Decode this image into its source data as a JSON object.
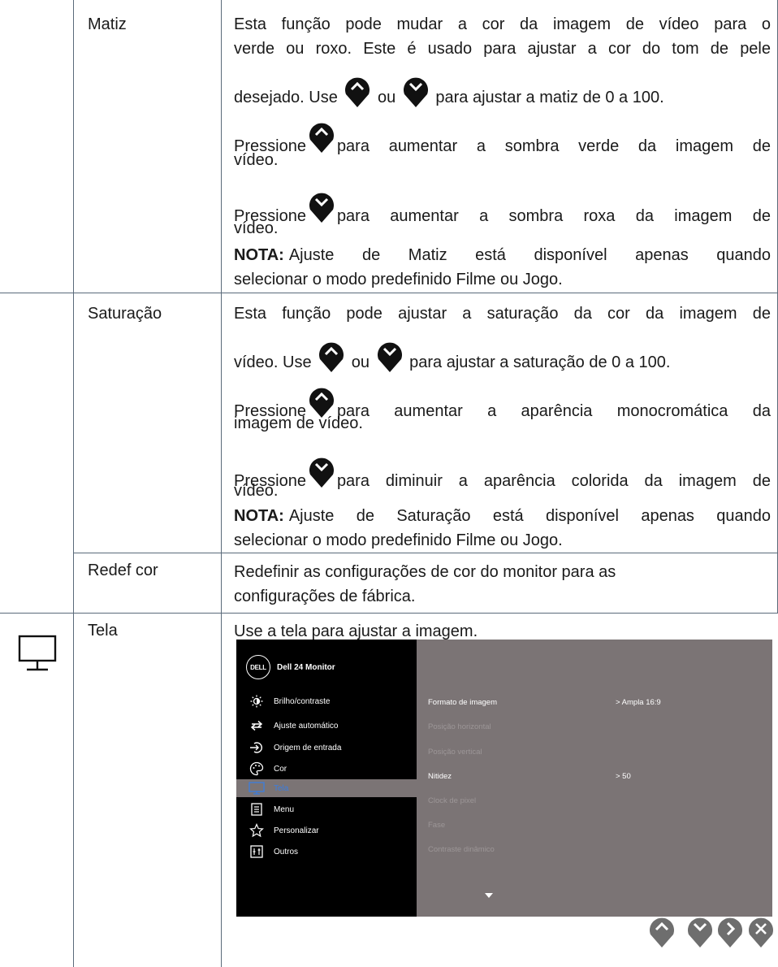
{
  "rows": {
    "hue": {
      "label": "Matiz",
      "line1": "Esta função pode mudar a cor da imagem de vídeo para o",
      "line2": "verde ou roxo. Este é usado para ajustar a cor do tom de pele",
      "line3_pre": "desejado. Use",
      "line3_mid": "ou",
      "line3_post": "para ajustar a matiz de 0 a 100.",
      "p2_pre": "Pressione",
      "p2_post": "para aumentar a sombra verde da imagem de",
      "p2_end": "vídeo.",
      "p3_pre": "Pressione",
      "p3_post": "para aumentar a sombra roxa da imagem de",
      "p3_end": "vídeo.",
      "note_label": "NOTA:",
      "note_line1": "Ajuste de Matiz está disponível apenas quando",
      "note_line2": "selecionar o modo predefinido Filme ou Jogo."
    },
    "saturation": {
      "label": "Saturação",
      "line1": "Esta função pode ajustar a saturação da cor da imagem de",
      "line2_pre": "vídeo. Use",
      "line2_mid": "ou",
      "line2_post": "para ajustar a saturação de 0 a 100.",
      "p2_pre": "Pressione",
      "p2_post": "para aumentar a aparência monocromática da",
      "p2_end": "imagem de vídeo.",
      "p3_pre": "Pressione",
      "p3_post": "para diminuir a aparência colorida da imagem de",
      "p3_end": "vídeo.",
      "note_label": "NOTA:",
      "note_line1": "Ajuste de Saturação está disponível apenas quando",
      "note_line2": "selecionar o modo predefinido Filme ou Jogo."
    },
    "reset": {
      "label": "Redef cor",
      "line1": "Redefinir as configurações de cor do monitor para as",
      "line2": "configurações de fábrica."
    },
    "display": {
      "icon": "monitor-icon",
      "label": "Tela",
      "line1": "Use a tela para ajustar a imagem."
    }
  },
  "osd": {
    "logo": "DELL",
    "title": "Dell 24 Monitor",
    "menu": [
      {
        "label": "Brilho/contraste",
        "icon": "brightness-icon"
      },
      {
        "label": "Ajuste automático",
        "icon": "auto-adjust-icon"
      },
      {
        "label": "Origem de entrada",
        "icon": "input-source-icon"
      },
      {
        "label": "Cor",
        "icon": "palette-icon"
      },
      {
        "label": "Tela",
        "icon": "display-icon"
      },
      {
        "label": "Menu",
        "icon": "menu-icon"
      },
      {
        "label": "Personalizar",
        "icon": "star-icon"
      },
      {
        "label": "Outros",
        "icon": "others-icon"
      }
    ],
    "options": [
      {
        "label": "Formato de imagem",
        "value": "> Ampla  16:9"
      },
      {
        "label": "Posição horizontal",
        "value": ""
      },
      {
        "label": "Posição vertical",
        "value": ""
      },
      {
        "label": "Nitidez",
        "value": "> 50"
      },
      {
        "label": "Clock de pixel",
        "value": ""
      },
      {
        "label": "Fase",
        "value": ""
      },
      {
        "label": "Contraste dinâmico",
        "value": ""
      }
    ]
  },
  "colors": {
    "border": "#5a6a7a",
    "osd_gray": "#7b7475",
    "osd_selected_text": "#3b7de0",
    "button_fill": "#6e6e6e"
  }
}
